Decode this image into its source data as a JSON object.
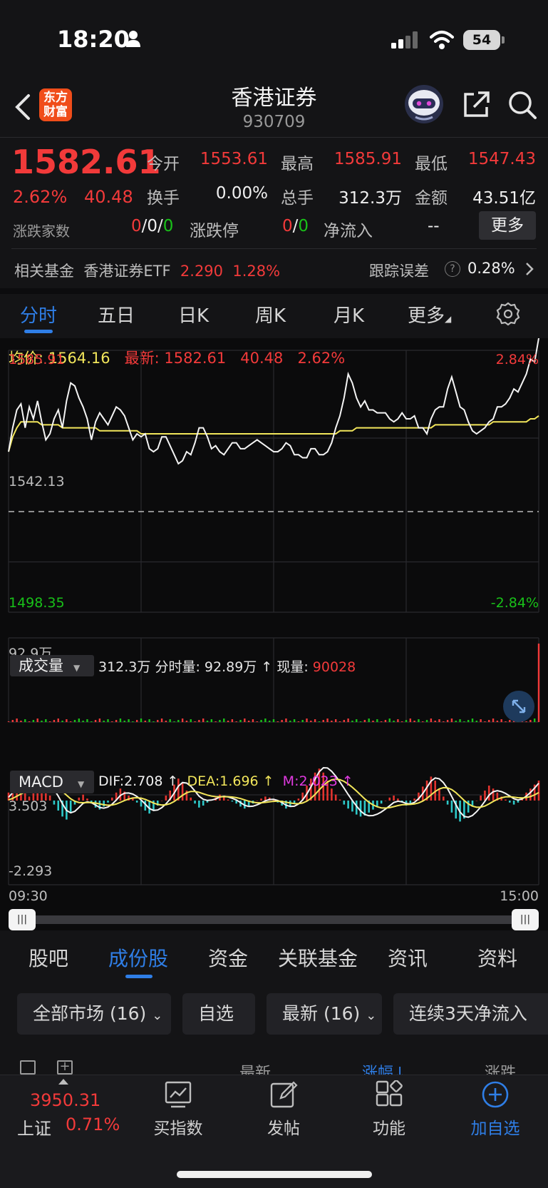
{
  "status_bar": {
    "time": "18:20",
    "battery": "54"
  },
  "header": {
    "logo_text_1": "东方",
    "logo_text_2": "财富",
    "title": "香港证券",
    "code": "930709"
  },
  "quote": {
    "price": "1582.61",
    "change_pct": "2.62%",
    "change": "40.48",
    "open_label": "今开",
    "open": "1553.61",
    "high_label": "最高",
    "high": "1585.91",
    "low_label": "最低",
    "low": "1547.43",
    "turnover_label": "换手",
    "turnover": "0.00%",
    "volume_label": "总手",
    "volume": "312.3万",
    "amount_label": "金额",
    "amount": "43.51亿",
    "breadth_label": "涨跌家数",
    "breadth_up": "0",
    "breadth_flat": "0",
    "breadth_down": "0",
    "limit_label": "涨跌停",
    "limit_up": "0",
    "limit_down": "0",
    "netflow_label": "净流入",
    "netflow": "--",
    "more_label": "更多"
  },
  "fund": {
    "label": "相关基金",
    "name": "香港证券ETF",
    "price": "2.290",
    "pct": "1.28%",
    "tracking_label": "跟踪误差",
    "tracking_value": "0.28%"
  },
  "chart_tabs": [
    "分时",
    "五日",
    "日K",
    "周K",
    "月K",
    "更多"
  ],
  "chart_info": {
    "avg_label": "均价:",
    "avg_value": "1564.16",
    "latest_label": "最新:",
    "latest_value": "1582.61",
    "latest_change": "40.48",
    "latest_pct": "2.62%"
  },
  "chart_data": {
    "type": "line",
    "title": "",
    "y_max": 1585.91,
    "y_prev_close": 1542.13,
    "y_min": 1498.35,
    "pct_max": "2.84%",
    "pct_min": "-2.84%",
    "x_start": "09:30",
    "x_end": "15:00",
    "series": [
      {
        "name": "最新",
        "values": [
          1552,
          1560,
          1566,
          1568,
          1560,
          1567,
          1563,
          1569,
          1562,
          1556,
          1558,
          1563,
          1566,
          1560,
          1569,
          1575,
          1574,
          1570,
          1567,
          1563,
          1556,
          1562,
          1565,
          1563,
          1561,
          1564,
          1567,
          1566,
          1564,
          1560,
          1556,
          1558,
          1557,
          1558,
          1553,
          1552,
          1553,
          1557,
          1557,
          1554,
          1551,
          1548,
          1549,
          1552,
          1551,
          1555,
          1560,
          1560,
          1557,
          1553,
          1554,
          1552,
          1551,
          1553,
          1555,
          1555,
          1553,
          1553,
          1554,
          1555,
          1556,
          1555,
          1554,
          1553,
          1552,
          1552,
          1553,
          1555,
          1554,
          1551,
          1551,
          1550,
          1550,
          1553,
          1553,
          1551,
          1551,
          1552,
          1555,
          1560,
          1564,
          1570,
          1578,
          1575,
          1570,
          1567,
          1569,
          1566,
          1566,
          1565,
          1565,
          1565,
          1563,
          1562,
          1563,
          1565,
          1563,
          1563,
          1564,
          1560,
          1560,
          1558,
          1563,
          1566,
          1567,
          1567,
          1573,
          1577,
          1572,
          1567,
          1566,
          1562,
          1559,
          1558,
          1559,
          1560,
          1562,
          1563,
          1567,
          1567,
          1568,
          1570,
          1573,
          1572,
          1575,
          1578,
          1583,
          1582,
          1590
        ]
      },
      {
        "name": "均价",
        "values": [
          1552,
          1557,
          1560,
          1562,
          1562,
          1562,
          1562,
          1562,
          1561,
          1561,
          1561,
          1561,
          1561,
          1560,
          1560,
          1560,
          1560,
          1560,
          1560,
          1560,
          1560,
          1560,
          1559,
          1559,
          1559,
          1559,
          1559,
          1559,
          1559,
          1559,
          1559,
          1559,
          1558,
          1558,
          1558,
          1558,
          1558,
          1558,
          1558,
          1558,
          1558,
          1558,
          1558,
          1558,
          1558,
          1558,
          1558,
          1558,
          1558,
          1558,
          1558,
          1558,
          1558,
          1558,
          1558,
          1558,
          1558,
          1558,
          1558,
          1558,
          1558,
          1558,
          1558,
          1558,
          1558,
          1558,
          1558,
          1558,
          1558,
          1558,
          1558,
          1558,
          1558,
          1558,
          1558,
          1558,
          1558,
          1558,
          1558,
          1558,
          1559,
          1559,
          1559,
          1559,
          1560,
          1560,
          1560,
          1560,
          1560,
          1560,
          1560,
          1560,
          1560,
          1560,
          1560,
          1560,
          1560,
          1560,
          1560,
          1560,
          1560,
          1560,
          1560,
          1561,
          1561,
          1561,
          1561,
          1561,
          1561,
          1561,
          1561,
          1561,
          1561,
          1561,
          1561,
          1561,
          1561,
          1562,
          1562,
          1562,
          1562,
          1562,
          1562,
          1562,
          1562,
          1562,
          1563,
          1563,
          1564
        ]
      }
    ]
  },
  "volume": {
    "label": "成交量",
    "total": "312.3万",
    "period_label": "分时量:",
    "period_value": "92.89万",
    "current_label": "现量:",
    "current_value": "90028",
    "axis_max": "92.9万"
  },
  "macd": {
    "label": "MACD",
    "dif": "DIF:2.708",
    "dea": "DEA:1.696",
    "m": "M:2.023",
    "axis_max": "3.503",
    "axis_min": "-2.293",
    "bars": [
      0.8,
      1.4,
      1.8,
      1.5,
      0.9,
      0.4,
      0.8,
      1.6,
      2.0,
      1.2,
      0.5,
      -0.4,
      -1.0,
      -1.6,
      -1.9,
      -1.2,
      -0.4,
      0.3,
      0.6,
      0.2,
      -0.3,
      -0.7,
      -0.9,
      -0.6,
      -0.2,
      0.3,
      0.8,
      1.2,
      0.9,
      0.5,
      0.2,
      -0.2,
      -0.6,
      -1.0,
      -1.3,
      -1.0,
      -0.5,
      0.0,
      0.5,
      1.0,
      1.6,
      2.2,
      1.8,
      1.0,
      0.3,
      -0.3,
      -0.7,
      -0.5,
      -0.2,
      0.1,
      0.3,
      0.6,
      0.4,
      0.1,
      -0.1,
      -0.3,
      -0.6,
      -0.8,
      -0.6,
      -0.3,
      0.0,
      0.2,
      0.4,
      0.3,
      0.1,
      -0.2,
      -0.5,
      -0.8,
      -0.6,
      -0.3,
      0.2,
      0.8,
      1.5,
      2.2,
      2.8,
      3.2,
      2.8,
      2.0,
      1.2,
      0.6,
      0.1,
      -0.4,
      -0.8,
      -1.1,
      -1.4,
      -1.6,
      -1.5,
      -1.2,
      -0.9,
      -0.6,
      -0.3,
      0.0,
      0.3,
      0.5,
      0.2,
      -0.2,
      -0.5,
      -0.3,
      0.2,
      0.8,
      1.4,
      2.0,
      2.4,
      2.0,
      1.2,
      0.4,
      -0.4,
      -1.2,
      -1.8,
      -2.1,
      -1.8,
      -1.2,
      -0.6,
      0.0,
      0.5,
      1.0,
      1.5,
      1.2,
      0.8,
      0.4,
      0.1,
      -0.2,
      -0.4,
      -0.2,
      0.3,
      0.8,
      1.2,
      1.6,
      2.0
    ]
  },
  "sub_tabs": [
    "股吧",
    "成份股",
    "资金",
    "关联基金",
    "资讯",
    "资料"
  ],
  "filters": [
    "全部市场 (16)",
    "自选",
    "最新 (16)",
    "连续3天净流入"
  ],
  "list_header": [
    "最新",
    "涨幅↓",
    "涨跌"
  ],
  "bottom_bar": {
    "index_value": "3950.31",
    "index_name": "上证",
    "index_pct": "0.71%",
    "items": [
      "买指数",
      "发帖",
      "功能",
      "加自选"
    ]
  }
}
